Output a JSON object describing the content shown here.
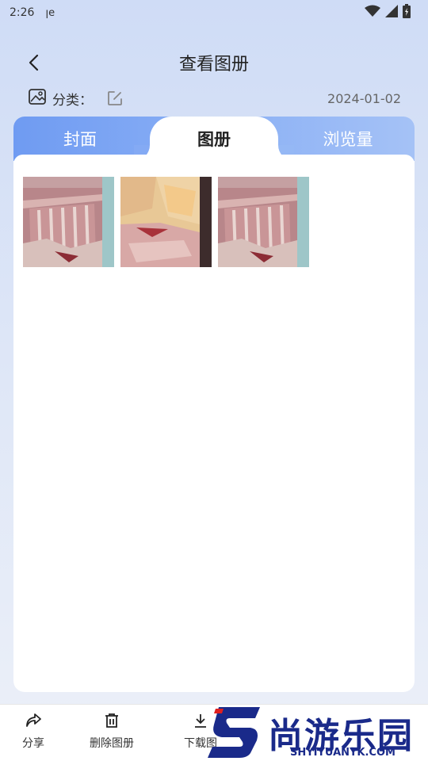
{
  "status_bar": {
    "time": "2:26",
    "app_indicator": "ꞁe"
  },
  "header": {
    "title": "查看图册"
  },
  "meta": {
    "category_label": "分类：",
    "date": "2024-01-02"
  },
  "tabs": [
    {
      "label": "封面",
      "active": false
    },
    {
      "label": "图册",
      "active": true
    },
    {
      "label": "浏览量",
      "active": false
    }
  ],
  "photos": [
    {
      "icon": "meat-ribs-photo"
    },
    {
      "icon": "meat-cut-photo"
    },
    {
      "icon": "meat-ribs-photo"
    }
  ],
  "actions": {
    "share": "分享",
    "delete": "删除图册",
    "download": "下载图"
  },
  "watermark": {
    "title": "尚游乐园",
    "url": "SHYIYUANYK.COM"
  }
}
